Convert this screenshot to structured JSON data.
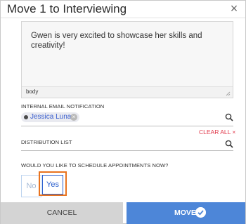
{
  "dialog": {
    "title": "Move 1 to Interviewing",
    "close_glyph": "×"
  },
  "editor": {
    "body_text": "Gwen is very excited to showcase her skills and creativity!",
    "path_label": "body"
  },
  "internal_email": {
    "label": "INTERNAL EMAIL NOTIFICATION",
    "recipients": [
      {
        "name": "Jessica Lunan",
        "remove_glyph": "×"
      }
    ],
    "clear_all_label": "CLEAR ALL ×"
  },
  "distribution_list": {
    "label": "DISTRIBUTION LIST"
  },
  "appointments": {
    "question": "WOULD YOU LIKE TO SCHEDULE APPOINTMENTS NOW?",
    "options": [
      "No",
      "Yes"
    ],
    "selected": "Yes"
  },
  "footer": {
    "cancel_label": "CANCEL",
    "move_label": "MOVE"
  },
  "colors": {
    "primary": "#4d86d8",
    "danger": "#e0394b",
    "highlight": "#e8731f"
  }
}
